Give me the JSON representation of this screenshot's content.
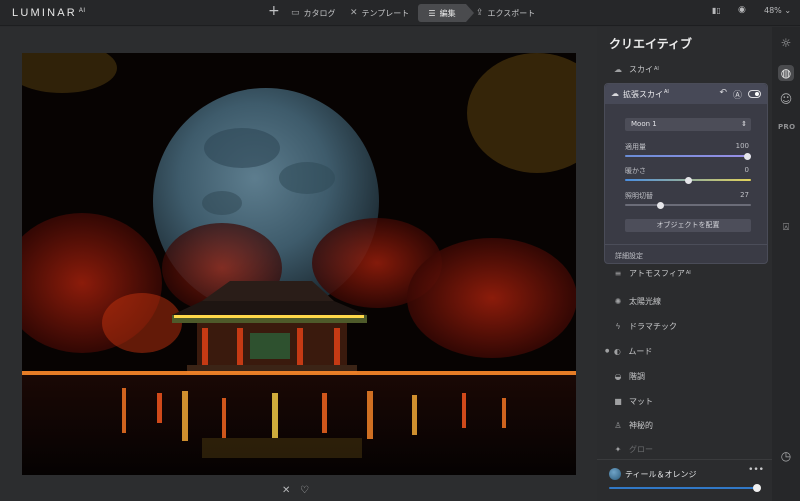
{
  "app": {
    "logo": "LUMINAR",
    "logo_sup": "AI"
  },
  "toolbar": {
    "add_icon": "+",
    "catalog_label": "カタログ",
    "templates_label": "テンプレート",
    "edit_label": "編集",
    "export_label": "エクスポート",
    "zoom": "48%"
  },
  "panel": {
    "title": "クリエイティブ",
    "sky_item": "スカイ",
    "sky_card": {
      "title": "拡張スカイ",
      "selected_sky": "Moon 1",
      "sliders": [
        {
          "label": "適用量",
          "value": "100",
          "fraction": 1.0
        },
        {
          "label": "暖かさ",
          "value": "0",
          "fraction": 0.5
        },
        {
          "label": "照明切替",
          "value": "27",
          "fraction": 0.27
        }
      ],
      "place_button": "オブジェクトを配置",
      "details_label": "詳細設定"
    },
    "items": [
      {
        "label": "アトモスフィア",
        "icon": "atmosphere-icon"
      },
      {
        "label": "太陽光線",
        "icon": "sunrays-icon"
      },
      {
        "label": "ドラマチック",
        "icon": "dramatic-icon"
      },
      {
        "label": "ムード",
        "icon": "mood-icon"
      },
      {
        "label": "階調",
        "icon": "toning-icon"
      },
      {
        "label": "マット",
        "icon": "matte-icon"
      },
      {
        "label": "神秘的",
        "icon": "mystical-icon"
      },
      {
        "label": "グロー",
        "icon": "glow-icon"
      }
    ],
    "preset": {
      "name": "ティール＆オレンジ",
      "amount": 1.0
    }
  },
  "colors": {
    "accent": "#3178c6",
    "panel_bg": "#2b2c2e",
    "card_bg": "#3a3b45"
  }
}
